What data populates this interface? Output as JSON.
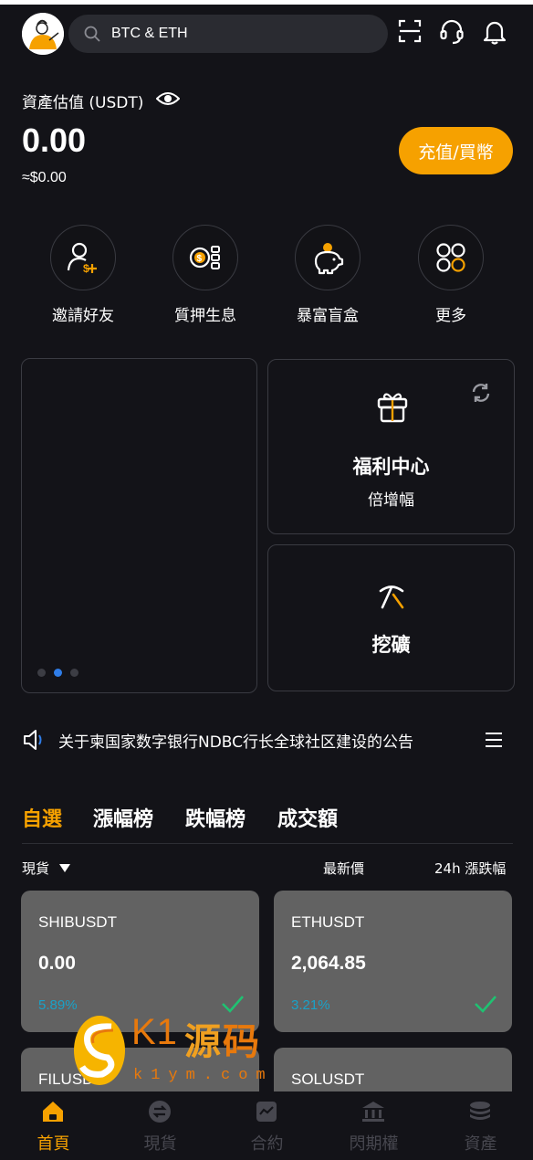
{
  "header": {
    "search_placeholder": "BTC & ETH"
  },
  "assets": {
    "label": "資產估值 (USDT)",
    "value": "0.00",
    "fiat": "≈$0.00",
    "deposit_button": "充值/買幣"
  },
  "quick_actions": [
    {
      "label": "邀請好友",
      "icon": "invite-friend-icon"
    },
    {
      "label": "質押生息",
      "icon": "staking-coins-icon"
    },
    {
      "label": "暴富盲盒",
      "icon": "piggy-bank-icon"
    },
    {
      "label": "更多",
      "icon": "more-grid-icon"
    }
  ],
  "banner": {
    "dots": 3,
    "active_dot": 1
  },
  "welfare": {
    "title": "福利中心",
    "subtitle": "倍增幅"
  },
  "mining": {
    "title": "挖礦"
  },
  "announcement": {
    "text": "关于柬国家数字银行NDBC行长全球社区建设的公告"
  },
  "market": {
    "tabs": [
      "自選",
      "漲幅榜",
      "跌幅榜",
      "成交額"
    ],
    "active_tab": 0,
    "columns": {
      "type": "現貨",
      "price": "最新價",
      "change": "24h 漲跌幅"
    },
    "coins": [
      {
        "symbol": "SHIBUSDT",
        "price": "0.00",
        "change": "5.89%"
      },
      {
        "symbol": "ETHUSDT",
        "price": "2,064.85",
        "change": "3.21%"
      },
      {
        "symbol": "FILUSDT",
        "price": "",
        "change": ""
      },
      {
        "symbol": "SOLUSDT",
        "price": "",
        "change": ""
      }
    ]
  },
  "watermark": {
    "k1": "K1",
    "yuan": "源",
    "ma": "码",
    "site": "k1ym.com"
  },
  "bottom_nav": [
    {
      "label": "首頁",
      "icon": "home-icon",
      "active": true
    },
    {
      "label": "現貨",
      "icon": "spot-exchange-icon",
      "active": false
    },
    {
      "label": "合約",
      "icon": "contract-chart-icon",
      "active": false
    },
    {
      "label": "閃期權",
      "icon": "bank-options-icon",
      "active": false
    },
    {
      "label": "資產",
      "icon": "assets-stack-icon",
      "active": false
    }
  ],
  "colors": {
    "accent": "#f6a100",
    "background": "#131318",
    "positive": "#19a2c8",
    "check": "#1fc272",
    "coin_card": "#626262"
  }
}
